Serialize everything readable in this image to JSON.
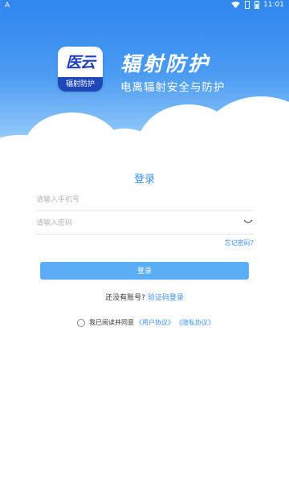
{
  "status_bar": {
    "left_icon": "A",
    "time": "11:01"
  },
  "brand": {
    "logo_text": "医云",
    "logo_band": "辐射防护",
    "title": "辐射防护",
    "subtitle": "电离辐射安全与防护"
  },
  "login": {
    "title": "登录",
    "phone_placeholder": "请输入手机号",
    "password_placeholder": "请输入密码",
    "forgot": "忘记密码?",
    "button": "登录",
    "no_account": "还没有账号?",
    "code_login": "验证码登录",
    "agree_prefix": "我已阅读并同意",
    "user_agreement": "《用户协议》",
    "privacy_agreement": "《隐私协议》"
  },
  "colors": {
    "accent": "#3a8ff0",
    "button": "#5aaef5",
    "logo_blue": "#1f47b8"
  },
  "icons": [
    "wifi-icon",
    "battery-icon",
    "vibrate-icon",
    "eye-icon"
  ]
}
